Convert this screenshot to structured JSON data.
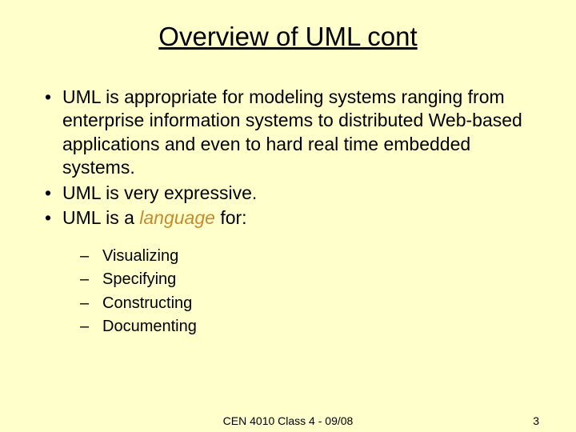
{
  "title": "Overview of UML cont",
  "bullets": [
    "UML is appropriate for modeling systems ranging from enterprise information systems to distributed Web-based applications and even to hard real time embedded systems.",
    "UML is very expressive."
  ],
  "bullet3_prefix": "UML is a ",
  "bullet3_emphasis": "language",
  "bullet3_suffix": " for:",
  "sub_items": [
    "Visualizing",
    "Specifying",
    "Constructing",
    "Documenting"
  ],
  "footer_center": "CEN 4010 Class 4 - 09/08",
  "footer_right": "3"
}
